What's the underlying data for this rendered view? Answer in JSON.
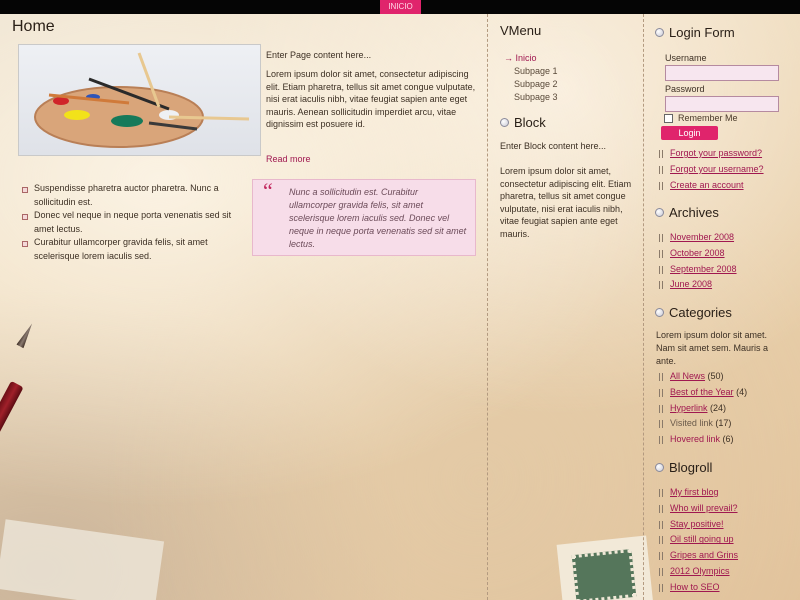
{
  "nav": {
    "items": [
      {
        "label": "INICIO"
      }
    ]
  },
  "colors": {
    "accent": "#e0246c",
    "link": "#a01850",
    "topbar": "#050505"
  },
  "main": {
    "title": "Home",
    "intro": "Enter Page content here...",
    "paragraph": "Lorem ipsum dolor sit amet, consectetur adipiscing elit. Etiam pharetra, tellus sit amet congue vulputate, nisi erat iaculis nibh, vitae feugiat sapien ante eget mauris. Aenean sollicitudin imperdiet arcu, vitae dignissim est posuere id.",
    "read_more": "Read more",
    "bullets": [
      "Suspendisse pharetra auctor pharetra. Nunc a sollicitudin est.",
      "Donec vel neque in neque porta venenatis sed sit amet lectus.",
      "Curabitur ullamcorper gravida felis, sit amet scelerisque lorem iaculis sed."
    ],
    "quote": "Nunc a sollicitudin est. Curabitur ullamcorper gravida felis, sit amet scelerisque lorem iaculis sed. Donec vel neque in neque porta venenatis sed sit amet lectus."
  },
  "vmenu": {
    "title": "VMenu",
    "items": [
      {
        "label": "Inicio",
        "active": true
      },
      {
        "label": "Subpage 1"
      },
      {
        "label": "Subpage 2"
      },
      {
        "label": "Subpage 3"
      }
    ]
  },
  "block": {
    "title": "Block",
    "intro": "Enter Block content here...",
    "text": "Lorem ipsum dolor sit amet, consectetur adipiscing elit. Etiam pharetra, tellus sit amet congue vulputate, nisi erat iaculis nibh, vitae feugiat sapien ante eget mauris."
  },
  "login": {
    "title": "Login Form",
    "username_label": "Username",
    "password_label": "Password",
    "remember_label": "Remember Me",
    "button_label": "Login",
    "links": [
      "Forgot your password?",
      "Forgot your username?",
      "Create an account"
    ]
  },
  "archives": {
    "title": "Archives",
    "items": [
      "November 2008",
      "October 2008",
      "September 2008",
      "June 2008"
    ]
  },
  "categories": {
    "title": "Categories",
    "text": "Lorem ipsum dolor sit amet. Nam sit amet sem. Mauris a ante.",
    "items": [
      {
        "label": "All News",
        "count": "(50)"
      },
      {
        "label": "Best of the Year",
        "count": "(4)"
      },
      {
        "label": "Hyperlink",
        "count": "(24)"
      },
      {
        "label": "Visited link",
        "count": "(17)"
      },
      {
        "label": "Hovered link",
        "count": "(6)"
      }
    ]
  },
  "blogroll": {
    "title": "Blogroll",
    "items": [
      "My first blog",
      "Who will prevail?",
      "Stay positive!",
      "Oil still going up",
      "Gripes and Grins",
      "2012 Olympics",
      "How to SEO"
    ]
  }
}
